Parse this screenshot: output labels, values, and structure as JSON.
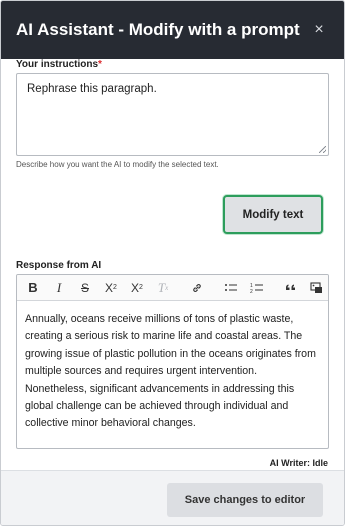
{
  "dialog": {
    "title": "AI Assistant - Modify with a prompt",
    "close_glyph": "×"
  },
  "instructions": {
    "label": "Your instructions",
    "required_mark": "*",
    "value": "Rephrase this paragraph.",
    "hint": "Describe how you want the AI to modify the selected text."
  },
  "modify_button": {
    "label": "Modify text"
  },
  "response": {
    "label": "Response from AI",
    "toolbar": {
      "bold": "B",
      "italic": "I",
      "strikethrough": "S",
      "superscript": "X²",
      "subscript": "X₂",
      "remove_format": "T",
      "link": "⊘",
      "bulleted_list": "☰",
      "numbered_list": "≡",
      "blockquote": "❝",
      "source": "⧉",
      "more": "⋮"
    },
    "content": "Annually, oceans receive millions of tons of plastic waste, creating a serious risk to marine life and coastal areas. The growing issue of plastic pollution in the oceans originates from multiple sources and requires urgent intervention. Nonetheless, significant advancements in addressing this global challenge can be achieved through individual and collective minor behavioral changes."
  },
  "status": "AI Writer: Idle",
  "footer": {
    "save_label": "Save changes to editor"
  },
  "colors": {
    "titlebar": "#272b33",
    "accent_focus": "#2d9d5c",
    "required": "#d9292c"
  }
}
